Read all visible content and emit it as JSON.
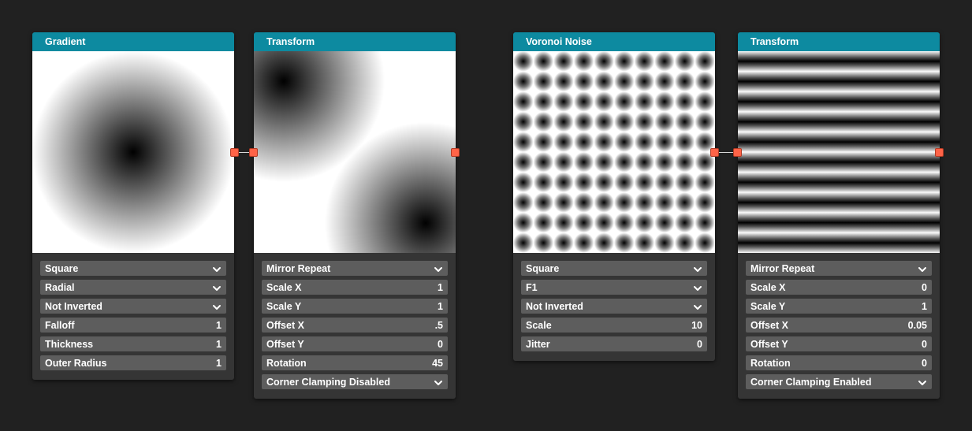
{
  "nodes": {
    "gradient": {
      "title": "Gradient",
      "params": [
        {
          "label": "Square",
          "kind": "dropdown"
        },
        {
          "label": "Radial",
          "kind": "dropdown"
        },
        {
          "label": "Not Inverted",
          "kind": "dropdown"
        },
        {
          "label": "Falloff",
          "value": "1"
        },
        {
          "label": "Thickness",
          "value": "1"
        },
        {
          "label": "Outer Radius",
          "value": "1"
        }
      ]
    },
    "transform1": {
      "title": "Transform",
      "params": [
        {
          "label": "Mirror Repeat",
          "kind": "dropdown"
        },
        {
          "label": "Scale X",
          "value": "1"
        },
        {
          "label": "Scale Y",
          "value": "1"
        },
        {
          "label": "Offset X",
          "value": ".5"
        },
        {
          "label": "Offset Y",
          "value": "0"
        },
        {
          "label": "Rotation",
          "value": "45"
        },
        {
          "label": "Corner Clamping Disabled",
          "kind": "dropdown"
        }
      ]
    },
    "voronoi": {
      "title": "Voronoi Noise",
      "params": [
        {
          "label": "Square",
          "kind": "dropdown"
        },
        {
          "label": "F1",
          "kind": "dropdown"
        },
        {
          "label": "Not Inverted",
          "kind": "dropdown"
        },
        {
          "label": "Scale",
          "value": "10"
        },
        {
          "label": "Jitter",
          "value": "0"
        }
      ]
    },
    "transform2": {
      "title": "Transform",
      "params": [
        {
          "label": "Mirror Repeat",
          "kind": "dropdown"
        },
        {
          "label": "Scale X",
          "value": "0"
        },
        {
          "label": "Scale Y",
          "value": "1"
        },
        {
          "label": "Offset X",
          "value": "0.05"
        },
        {
          "label": "Offset Y",
          "value": "0"
        },
        {
          "label": "Rotation",
          "value": "0"
        },
        {
          "label": "Corner Clamping Enabled",
          "kind": "dropdown"
        }
      ]
    }
  },
  "colors": {
    "background": "#212121",
    "node_body": "#353535",
    "node_header": "#0d8aa0",
    "param_field": "#5d5d5d",
    "port": "#ff6347",
    "wire": "#d8d8d8"
  },
  "icons": {
    "dropdown": "chevron-down-icon"
  }
}
